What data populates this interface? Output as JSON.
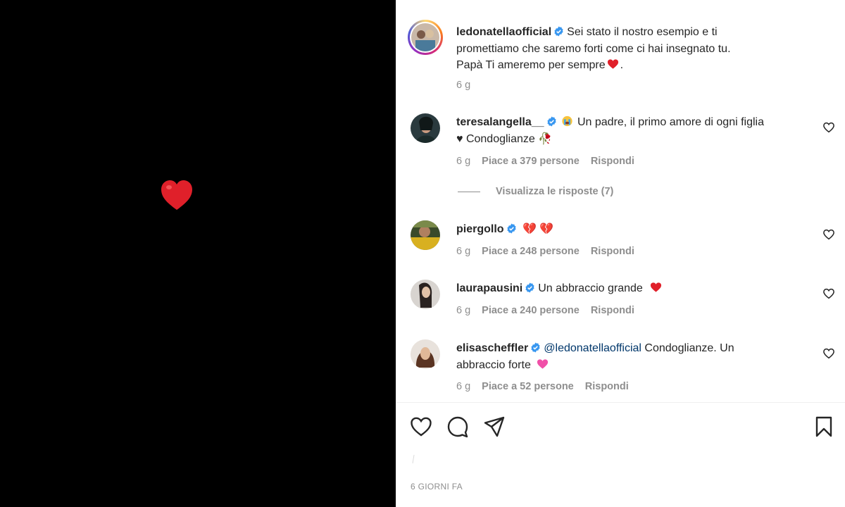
{
  "post": {
    "author": "ledonatellaofficial",
    "caption_line1": "Sei stato il nostro esempio e ti",
    "caption_line2": "promettiamo che saremo forti come ci hai insegnato tu.",
    "caption_line3": "Papà Ti ameremo per sempre",
    "caption_end": ".",
    "age": "6 g",
    "timestamp": "6 GIORNI FA"
  },
  "comments": [
    {
      "username": "teresalangella__",
      "text_line1": "Un padre, il primo amore di ogni figlia",
      "text_line2": "♥ Condoglianze 🥀",
      "age": "6 g",
      "likes": "Piace a 379 persone",
      "reply": "Rispondi",
      "view_replies": "Visualizza le risposte (7)"
    },
    {
      "username": "piergollo",
      "text": "💔 💔",
      "age": "6 g",
      "likes": "Piace a 248 persone",
      "reply": "Rispondi"
    },
    {
      "username": "laurapausini",
      "text": "Un abbraccio grande",
      "age": "6 g",
      "likes": "Piace a 240 persone",
      "reply": "Rispondi"
    },
    {
      "username": "elisascheffler",
      "mention": "@ledonatellaofficial",
      "text_line1": " Condoglianze. Un",
      "text_line2": "abbraccio forte",
      "age": "6 g",
      "likes": "Piace a 52 persone",
      "reply": "Rispondi"
    }
  ],
  "icons": {
    "like": "heart-outline-icon",
    "comment": "comment-bubble-icon",
    "share": "paper-plane-icon",
    "save": "bookmark-icon",
    "verified": "verified-badge-icon"
  },
  "colors": {
    "verified_blue": "#3897f0",
    "heart_red": "#ed4956",
    "text_primary": "#262626",
    "text_secondary": "#8e8e8e",
    "mention": "#00376b"
  }
}
